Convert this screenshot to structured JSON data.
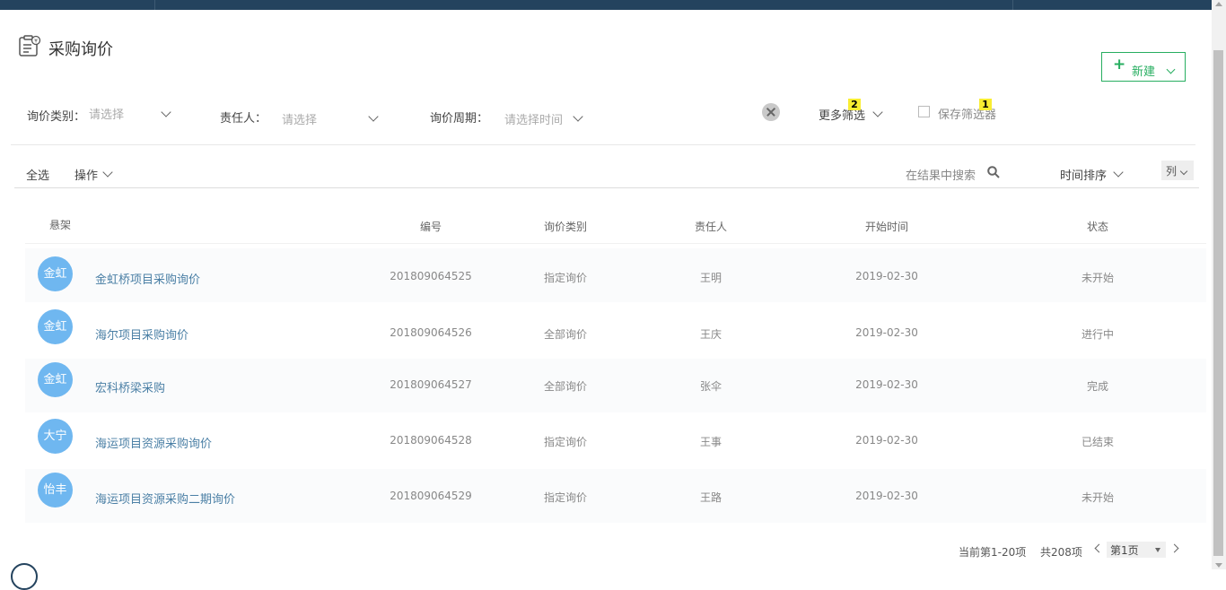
{
  "page": {
    "title": "采购询价",
    "new_button": "新建"
  },
  "filters": {
    "category_label": "询价类别：",
    "category_placeholder": "请选择",
    "owner_label": "责任人：",
    "owner_placeholder": "请选择",
    "period_label": "询价周期：",
    "period_placeholder": "请选择时间",
    "more_filter": "更多筛选",
    "more_filter_badge": "2",
    "save_filter": "保存筛选器",
    "save_filter_badge": "1"
  },
  "toolbar": {
    "select_all": "全选",
    "actions": "操作",
    "search_placeholder": "在结果中搜索",
    "sort": "时间排序",
    "columns": "列"
  },
  "table": {
    "headers": {
      "listing": "悬架",
      "code": "编号",
      "category": "询价类别",
      "owner": "责任人",
      "start_time": "开始时间",
      "status": "状态"
    },
    "rows": [
      {
        "avatar": "金虹",
        "name": "金虹桥项目采购询价",
        "code": "201809064525",
        "category": "指定询价",
        "owner": "王明",
        "start_time": "2019-02-30",
        "status": "未开始"
      },
      {
        "avatar": "金虹",
        "name": "海尔项目采购询价",
        "code": "201809064526",
        "category": "全部询价",
        "owner": "王庆",
        "start_time": "2019-02-30",
        "status": "进行中"
      },
      {
        "avatar": "金虹",
        "name": "宏科桥梁采购",
        "code": "201809064527",
        "category": "全部询价",
        "owner": "张伞",
        "start_time": "2019-02-30",
        "status": "完成"
      },
      {
        "avatar": "大宁",
        "name": "海运项目资源采购询价",
        "code": "201809064528",
        "category": "指定询价",
        "owner": "王事",
        "start_time": "2019-02-30",
        "status": "已结束"
      },
      {
        "avatar": "怡丰",
        "name": "海运项目资源采购二期询价",
        "code": "201809064529",
        "category": "指定询价",
        "owner": "王路",
        "start_time": "2019-02-30",
        "status": "未开始"
      }
    ]
  },
  "pagination": {
    "current_range": "当前第1-20项",
    "total": "共208项",
    "page_select": "第1页"
  },
  "colors": {
    "topbar": "#24435e",
    "accent_green": "#27ae60",
    "avatar_blue": "#6fb7f0",
    "link_blue": "#4a7fa5"
  }
}
